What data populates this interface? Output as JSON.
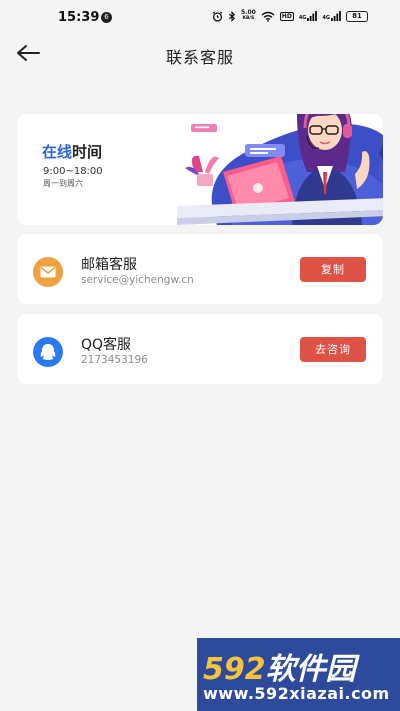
{
  "status_bar": {
    "time": "15:39",
    "notification_count": "6",
    "network_speed_value": "5.00",
    "network_speed_unit": "KB/S",
    "hd_label": "HD",
    "signal1_label": "4G",
    "signal2_label": "4G",
    "battery": "81"
  },
  "header": {
    "title": "联系客服"
  },
  "hours_card": {
    "title_accent": "在线",
    "title_rest": "时间",
    "hours": "9:00~18:00",
    "days": "周一到周六"
  },
  "contacts": [
    {
      "title": "邮箱客服",
      "value": "service@yichengw.cn",
      "button": "复制",
      "icon": "mail-icon",
      "icon_color": "#f0a040"
    },
    {
      "title": "QQ客服",
      "value": "2173453196",
      "button": "去咨询",
      "icon": "qq-icon",
      "icon_color": "#2a7bef"
    }
  ],
  "colors": {
    "accent_blue": "#2b66d9",
    "button_red": "#de5246",
    "background": "#f4f4f5"
  },
  "watermark": {
    "brand_number": "592",
    "brand_text": "软件园",
    "url": "www.592xiazai.com"
  }
}
